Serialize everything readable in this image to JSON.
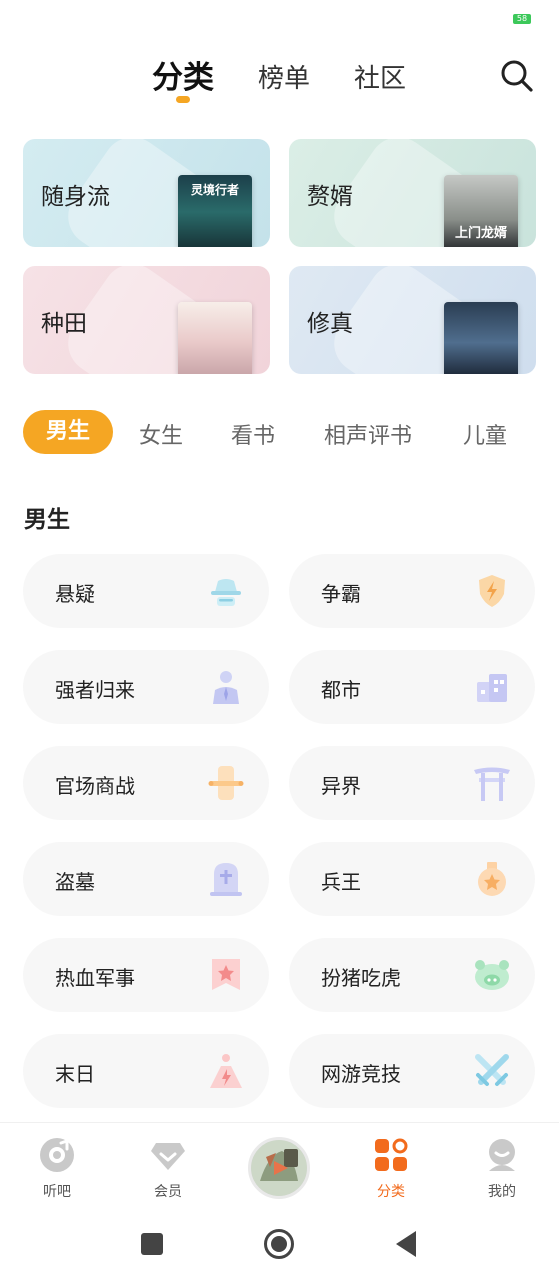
{
  "status_bar": {
    "battery": "58"
  },
  "header": {
    "tabs": [
      "分类",
      "榜单",
      "社区"
    ],
    "active_tab": "分类"
  },
  "colors": {
    "accent": "#f5a623",
    "nav_active": "#f26b1d"
  },
  "featured": [
    {
      "label": "随身流",
      "cover_text": "灵境行者"
    },
    {
      "label": "赘婿",
      "cover_text": "上门龙婿"
    },
    {
      "label": "种田",
      "cover_text": ""
    },
    {
      "label": "修真",
      "cover_text": ""
    }
  ],
  "category_tabs": [
    "男生",
    "女生",
    "看书",
    "相声评书",
    "儿童"
  ],
  "section": {
    "title": "男生",
    "items": [
      {
        "label": "悬疑",
        "icon": "detective-hat-icon"
      },
      {
        "label": "争霸",
        "icon": "lightning-shield-icon"
      },
      {
        "label": "强者归来",
        "icon": "businessman-icon"
      },
      {
        "label": "都市",
        "icon": "building-icon"
      },
      {
        "label": "官场商战",
        "icon": "scroll-icon"
      },
      {
        "label": "异界",
        "icon": "torii-gate-icon"
      },
      {
        "label": "盗墓",
        "icon": "tombstone-icon"
      },
      {
        "label": "兵王",
        "icon": "medal-icon"
      },
      {
        "label": "热血军事",
        "icon": "star-banner-icon"
      },
      {
        "label": "扮猪吃虎",
        "icon": "pig-icon"
      },
      {
        "label": "末日",
        "icon": "volcano-icon"
      },
      {
        "label": "网游竞技",
        "icon": "crossed-swords-icon"
      }
    ]
  },
  "bottom_nav": [
    {
      "label": "听吧",
      "icon": "disc-icon"
    },
    {
      "label": "会员",
      "icon": "diamond-icon"
    },
    {
      "label": "",
      "icon": "player-icon"
    },
    {
      "label": "分类",
      "icon": "grid-icon"
    },
    {
      "label": "我的",
      "icon": "profile-icon"
    }
  ]
}
